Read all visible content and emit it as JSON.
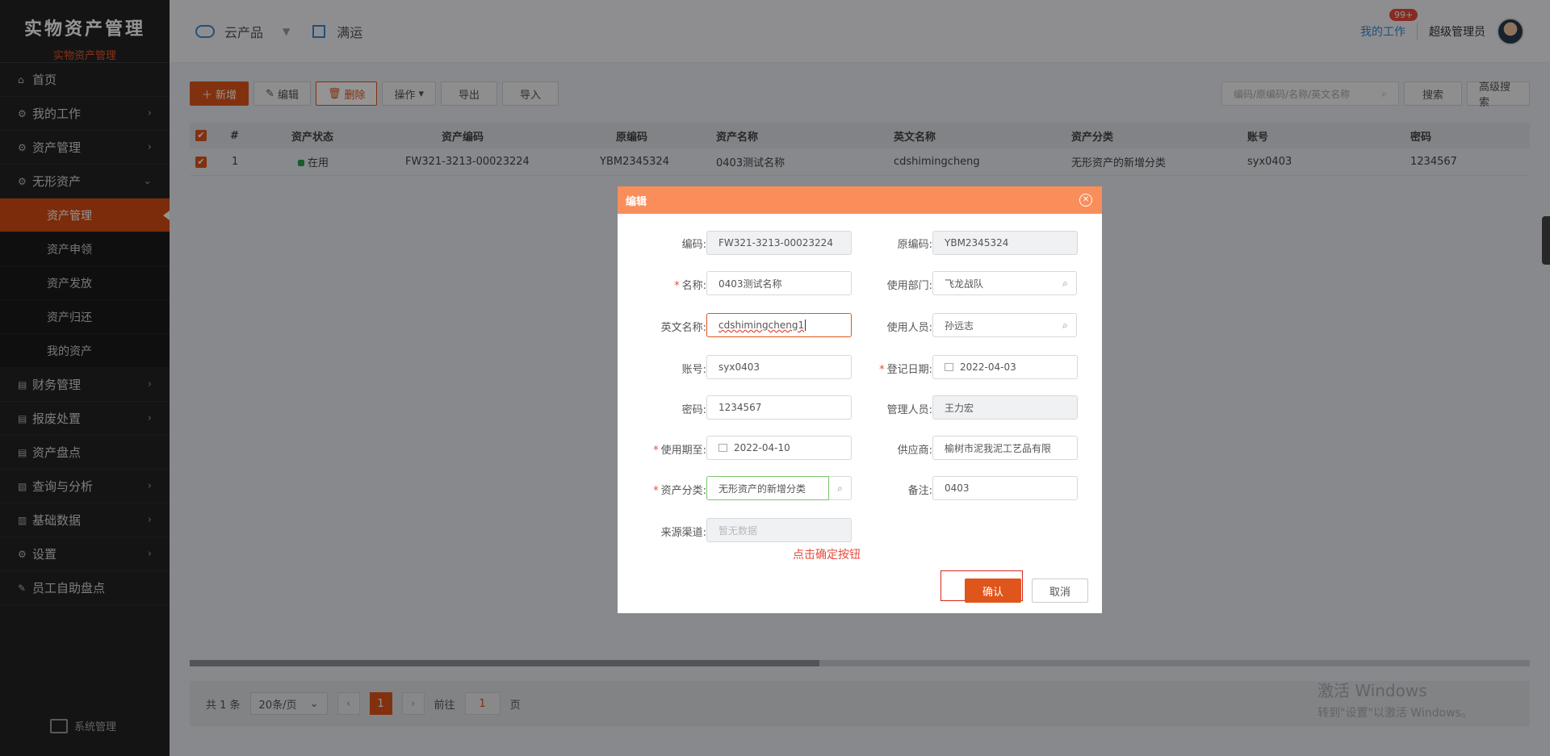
{
  "sidebar": {
    "title": "实物资产管理",
    "subtitle": "实物资产管理",
    "items": [
      {
        "label": "首页",
        "icon": "home-icon",
        "has_children": false
      },
      {
        "label": "我的工作",
        "icon": "gear-icon",
        "has_children": true
      },
      {
        "label": "资产管理",
        "icon": "gear-icon",
        "has_children": true
      },
      {
        "label": "无形资产",
        "icon": "gear-icon",
        "has_children": true,
        "expanded": true
      }
    ],
    "sub_items": [
      {
        "label": "资产管理",
        "active": true
      },
      {
        "label": "资产申领",
        "active": false
      },
      {
        "label": "资产发放",
        "active": false
      },
      {
        "label": "资产归还",
        "active": false
      },
      {
        "label": "我的资产",
        "active": false
      }
    ],
    "items_after": [
      {
        "label": "财务管理",
        "icon": "document-icon",
        "has_children": true
      },
      {
        "label": "报废处置",
        "icon": "document-icon",
        "has_children": true
      },
      {
        "label": "资产盘点",
        "icon": "document-icon",
        "has_children": false
      },
      {
        "label": "查询与分析",
        "icon": "chart-icon",
        "has_children": true
      },
      {
        "label": "基础数据",
        "icon": "bar-chart-icon",
        "has_children": true
      },
      {
        "label": "设置",
        "icon": "gear-icon",
        "has_children": true
      },
      {
        "label": "员工自助盘点",
        "icon": "edit-icon",
        "has_children": false
      }
    ],
    "footer": "系统管理"
  },
  "header": {
    "nav1": "云产品",
    "nav2": "满运",
    "my_work": "我的工作",
    "badge": "99+",
    "user": "超级管理员"
  },
  "toolbar": {
    "add": "新增",
    "edit": "编辑",
    "delete": "删除",
    "operate": "操作",
    "export": "导出",
    "import": "导入",
    "search_placeholder": "编码/原编码/名称/英文名称",
    "search": "搜索",
    "advanced_search": "高级搜索"
  },
  "table": {
    "columns": [
      "#",
      "资产状态",
      "资产编码",
      "原编码",
      "资产名称",
      "英文名称",
      "资产分类",
      "账号",
      "密码"
    ],
    "rows": [
      {
        "index": "1",
        "status": "在用",
        "code": "FW321-3213-00023224",
        "orig_code": "YBM2345324",
        "name": "0403测试名称",
        "en_name": "cdshimingcheng",
        "category": "无形资产的新增分类",
        "account": "syx0403",
        "password": "1234567"
      }
    ]
  },
  "pager": {
    "total": "共 1 条",
    "page_size": "20条/页",
    "current": "1",
    "goto_label": "前往",
    "goto_value": "1",
    "goto_suffix": "页"
  },
  "windows_activation": {
    "line1": "激活 Windows",
    "line2": "转到\"设置\"以激活 Windows。"
  },
  "dialog": {
    "title": "编辑",
    "fields": {
      "code_label": "编码:",
      "code_value": "FW321-3213-00023224",
      "orig_code_label": "原编码:",
      "orig_code_value": "YBM2345324",
      "name_label": "名称:",
      "name_value": "0403测试名称",
      "dept_label": "使用部门:",
      "dept_value": "飞龙战队",
      "en_name_label": "英文名称:",
      "en_name_value": "cdshimingcheng1",
      "user_label": "使用人员:",
      "user_value": "孙远志",
      "account_label": "账号:",
      "account_value": "syx0403",
      "reg_date_label": "登记日期:",
      "reg_date_value": "2022-04-03",
      "password_label": "密码:",
      "password_value": "1234567",
      "manager_label": "管理人员:",
      "manager_value": "王力宏",
      "expire_label": "使用期至:",
      "expire_value": "2022-04-10",
      "supplier_label": "供应商:",
      "supplier_value": "榆树市泥我泥工艺品有限",
      "category_label": "资产分类:",
      "category_value": "无形资产的新增分类",
      "remark_label": "备注:",
      "remark_value": "0403",
      "source_label": "来源渠道:",
      "source_placeholder": "暂无数据"
    },
    "hint": "点击确定按钮",
    "ok": "确认",
    "cancel": "取消"
  }
}
